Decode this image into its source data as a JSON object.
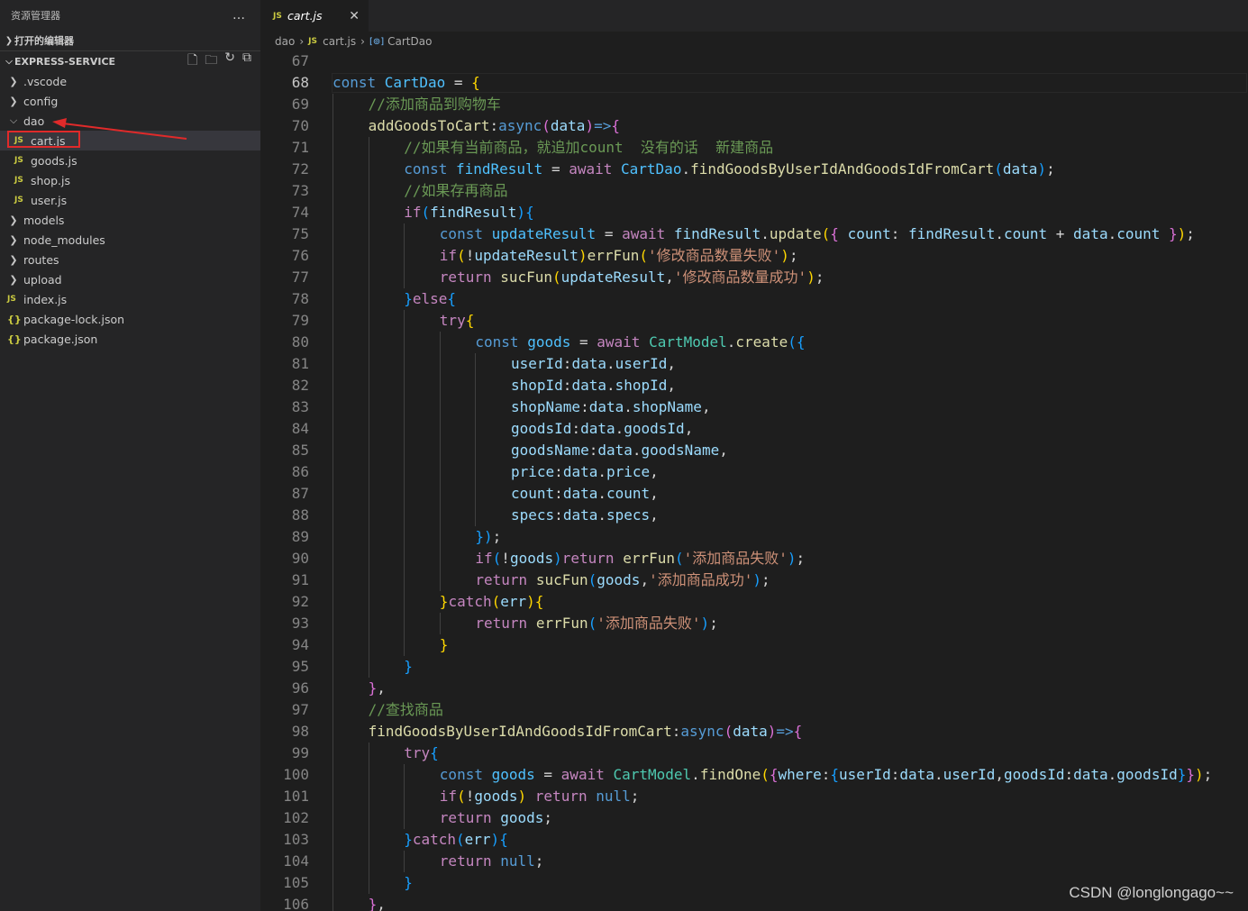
{
  "sidebar": {
    "title": "资源管理器",
    "more_icon": "…",
    "open_editors_label": "打开的编辑器",
    "project_label": "EXPRESS-SERVICE",
    "tree": [
      {
        "label": ".vscode",
        "kind": "folder",
        "level": 0,
        "expanded": false
      },
      {
        "label": "config",
        "kind": "folder",
        "level": 0,
        "expanded": false
      },
      {
        "label": "dao",
        "kind": "folder",
        "level": 0,
        "expanded": true
      },
      {
        "label": "cart.js",
        "kind": "js",
        "level": 1,
        "selected": true
      },
      {
        "label": "goods.js",
        "kind": "js",
        "level": 1
      },
      {
        "label": "shop.js",
        "kind": "js",
        "level": 1
      },
      {
        "label": "user.js",
        "kind": "js",
        "level": 1
      },
      {
        "label": "models",
        "kind": "folder",
        "level": 0,
        "expanded": false
      },
      {
        "label": "node_modules",
        "kind": "folder",
        "level": 0,
        "expanded": false
      },
      {
        "label": "routes",
        "kind": "folder",
        "level": 0,
        "expanded": false
      },
      {
        "label": "upload",
        "kind": "folder",
        "level": 0,
        "expanded": false
      },
      {
        "label": "index.js",
        "kind": "js",
        "level": 0
      },
      {
        "label": "package-lock.json",
        "kind": "json",
        "level": 0
      },
      {
        "label": "package.json",
        "kind": "json",
        "level": 0
      }
    ]
  },
  "tab": {
    "icon": "JS",
    "label": "cart.js",
    "close": "✕"
  },
  "breadcrumb": {
    "folder": "dao",
    "file": "cart.js",
    "symbol": "CartDao"
  },
  "editor": {
    "active_line": 68,
    "lines": [
      {
        "n": "67",
        "indent": 0,
        "tokens": []
      },
      {
        "n": "68",
        "indent": 0,
        "tokens": [
          [
            "k",
            "const "
          ],
          [
            "cv",
            "CartDao"
          ],
          [
            "p",
            " = "
          ],
          [
            "b1",
            "{"
          ]
        ]
      },
      {
        "n": "69",
        "indent": 1,
        "tokens": [
          [
            "cm",
            "//添加商品到购物车"
          ]
        ]
      },
      {
        "n": "70",
        "indent": 1,
        "tokens": [
          [
            "f",
            "addGoodsToCart"
          ],
          [
            "p",
            ":"
          ],
          [
            "k",
            "async"
          ],
          [
            "b2",
            "("
          ],
          [
            "v",
            "data"
          ],
          [
            "b2",
            ")"
          ],
          [
            "k",
            "=>"
          ],
          [
            "b2",
            "{"
          ]
        ]
      },
      {
        "n": "71",
        "indent": 2,
        "tokens": [
          [
            "cm",
            "//如果有当前商品，就追加count  没有的话  新建商品"
          ]
        ]
      },
      {
        "n": "72",
        "indent": 2,
        "tokens": [
          [
            "k",
            "const "
          ],
          [
            "cv",
            "findResult"
          ],
          [
            "p",
            " = "
          ],
          [
            "c",
            "await "
          ],
          [
            "cv",
            "CartDao"
          ],
          [
            "p",
            "."
          ],
          [
            "f",
            "findGoodsByUserIdAndGoodsIdFromCart"
          ],
          [
            "b3",
            "("
          ],
          [
            "v",
            "data"
          ],
          [
            "b3",
            ")"
          ],
          [
            "p",
            ";"
          ]
        ]
      },
      {
        "n": "73",
        "indent": 2,
        "tokens": [
          [
            "cm",
            "//如果存再商品"
          ]
        ]
      },
      {
        "n": "74",
        "indent": 2,
        "tokens": [
          [
            "c",
            "if"
          ],
          [
            "b3",
            "("
          ],
          [
            "v",
            "findResult"
          ],
          [
            "b3",
            ")"
          ],
          [
            "b3",
            "{"
          ]
        ]
      },
      {
        "n": "75",
        "indent": 3,
        "tokens": [
          [
            "k",
            "const "
          ],
          [
            "cv",
            "updateResult"
          ],
          [
            "p",
            " = "
          ],
          [
            "c",
            "await "
          ],
          [
            "v",
            "findResult"
          ],
          [
            "p",
            "."
          ],
          [
            "f",
            "update"
          ],
          [
            "b1",
            "("
          ],
          [
            "b2",
            "{ "
          ],
          [
            "v",
            "count"
          ],
          [
            "p",
            ": "
          ],
          [
            "v",
            "findResult"
          ],
          [
            "p",
            "."
          ],
          [
            "v",
            "count"
          ],
          [
            "p",
            " + "
          ],
          [
            "v",
            "data"
          ],
          [
            "p",
            "."
          ],
          [
            "v",
            "count"
          ],
          [
            "b2",
            " }"
          ],
          [
            "b1",
            ")"
          ],
          [
            "p",
            ";"
          ]
        ]
      },
      {
        "n": "76",
        "indent": 3,
        "tokens": [
          [
            "c",
            "if"
          ],
          [
            "b1",
            "("
          ],
          [
            "p",
            "!"
          ],
          [
            "v",
            "updateResult"
          ],
          [
            "b1",
            ")"
          ],
          [
            "f",
            "errFun"
          ],
          [
            "b1",
            "("
          ],
          [
            "s",
            "'修改商品数量失败'"
          ],
          [
            "b1",
            ")"
          ],
          [
            "p",
            ";"
          ]
        ]
      },
      {
        "n": "77",
        "indent": 3,
        "tokens": [
          [
            "c",
            "return "
          ],
          [
            "f",
            "sucFun"
          ],
          [
            "b1",
            "("
          ],
          [
            "v",
            "updateResult"
          ],
          [
            "p",
            ","
          ],
          [
            "s",
            "'修改商品数量成功'"
          ],
          [
            "b1",
            ")"
          ],
          [
            "p",
            ";"
          ]
        ]
      },
      {
        "n": "78",
        "indent": 2,
        "tokens": [
          [
            "b3",
            "}"
          ],
          [
            "c",
            "else"
          ],
          [
            "b3",
            "{"
          ]
        ]
      },
      {
        "n": "79",
        "indent": 3,
        "tokens": [
          [
            "c",
            "try"
          ],
          [
            "b1",
            "{"
          ]
        ]
      },
      {
        "n": "80",
        "indent": 4,
        "tokens": [
          [
            "k",
            "const "
          ],
          [
            "cv",
            "goods"
          ],
          [
            "p",
            " = "
          ],
          [
            "c",
            "await "
          ],
          [
            "t",
            "CartModel"
          ],
          [
            "p",
            "."
          ],
          [
            "f",
            "create"
          ],
          [
            "b3",
            "("
          ],
          [
            "b3",
            "{"
          ]
        ]
      },
      {
        "n": "81",
        "indent": 5,
        "tokens": [
          [
            "v",
            "userId"
          ],
          [
            "p",
            ":"
          ],
          [
            "v",
            "data"
          ],
          [
            "p",
            "."
          ],
          [
            "v",
            "userId"
          ],
          [
            "p",
            ","
          ]
        ]
      },
      {
        "n": "82",
        "indent": 5,
        "tokens": [
          [
            "v",
            "shopId"
          ],
          [
            "p",
            ":"
          ],
          [
            "v",
            "data"
          ],
          [
            "p",
            "."
          ],
          [
            "v",
            "shopId"
          ],
          [
            "p",
            ","
          ]
        ]
      },
      {
        "n": "83",
        "indent": 5,
        "tokens": [
          [
            "v",
            "shopName"
          ],
          [
            "p",
            ":"
          ],
          [
            "v",
            "data"
          ],
          [
            "p",
            "."
          ],
          [
            "v",
            "shopName"
          ],
          [
            "p",
            ","
          ]
        ]
      },
      {
        "n": "84",
        "indent": 5,
        "tokens": [
          [
            "v",
            "goodsId"
          ],
          [
            "p",
            ":"
          ],
          [
            "v",
            "data"
          ],
          [
            "p",
            "."
          ],
          [
            "v",
            "goodsId"
          ],
          [
            "p",
            ","
          ]
        ]
      },
      {
        "n": "85",
        "indent": 5,
        "tokens": [
          [
            "v",
            "goodsName"
          ],
          [
            "p",
            ":"
          ],
          [
            "v",
            "data"
          ],
          [
            "p",
            "."
          ],
          [
            "v",
            "goodsName"
          ],
          [
            "p",
            ","
          ]
        ]
      },
      {
        "n": "86",
        "indent": 5,
        "tokens": [
          [
            "v",
            "price"
          ],
          [
            "p",
            ":"
          ],
          [
            "v",
            "data"
          ],
          [
            "p",
            "."
          ],
          [
            "v",
            "price"
          ],
          [
            "p",
            ","
          ]
        ]
      },
      {
        "n": "87",
        "indent": 5,
        "tokens": [
          [
            "v",
            "count"
          ],
          [
            "p",
            ":"
          ],
          [
            "v",
            "data"
          ],
          [
            "p",
            "."
          ],
          [
            "v",
            "count"
          ],
          [
            "p",
            ","
          ]
        ]
      },
      {
        "n": "88",
        "indent": 5,
        "tokens": [
          [
            "v",
            "specs"
          ],
          [
            "p",
            ":"
          ],
          [
            "v",
            "data"
          ],
          [
            "p",
            "."
          ],
          [
            "v",
            "specs"
          ],
          [
            "p",
            ","
          ]
        ]
      },
      {
        "n": "89",
        "indent": 4,
        "tokens": [
          [
            "b3",
            "}"
          ],
          [
            "b3",
            ")"
          ],
          [
            "p",
            ";"
          ]
        ]
      },
      {
        "n": "90",
        "indent": 4,
        "tokens": [
          [
            "c",
            "if"
          ],
          [
            "b3",
            "("
          ],
          [
            "p",
            "!"
          ],
          [
            "v",
            "goods"
          ],
          [
            "b3",
            ")"
          ],
          [
            "c",
            "return "
          ],
          [
            "f",
            "errFun"
          ],
          [
            "b3",
            "("
          ],
          [
            "s",
            "'添加商品失败'"
          ],
          [
            "b3",
            ")"
          ],
          [
            "p",
            ";"
          ]
        ]
      },
      {
        "n": "91",
        "indent": 4,
        "tokens": [
          [
            "c",
            "return "
          ],
          [
            "f",
            "sucFun"
          ],
          [
            "b3",
            "("
          ],
          [
            "v",
            "goods"
          ],
          [
            "p",
            ","
          ],
          [
            "s",
            "'添加商品成功'"
          ],
          [
            "b3",
            ")"
          ],
          [
            "p",
            ";"
          ]
        ]
      },
      {
        "n": "92",
        "indent": 3,
        "tokens": [
          [
            "b1",
            "}"
          ],
          [
            "c",
            "catch"
          ],
          [
            "b1",
            "("
          ],
          [
            "v",
            "err"
          ],
          [
            "b1",
            ")"
          ],
          [
            "b1",
            "{"
          ]
        ]
      },
      {
        "n": "93",
        "indent": 4,
        "tokens": [
          [
            "c",
            "return "
          ],
          [
            "f",
            "errFun"
          ],
          [
            "b3",
            "("
          ],
          [
            "s",
            "'添加商品失败'"
          ],
          [
            "b3",
            ")"
          ],
          [
            "p",
            ";"
          ]
        ]
      },
      {
        "n": "94",
        "indent": 3,
        "tokens": [
          [
            "b1",
            "}"
          ]
        ]
      },
      {
        "n": "95",
        "indent": 2,
        "tokens": [
          [
            "b3",
            "}"
          ]
        ]
      },
      {
        "n": "96",
        "indent": 1,
        "tokens": [
          [
            "b2",
            "}"
          ],
          [
            "p",
            ","
          ]
        ]
      },
      {
        "n": "97",
        "indent": 1,
        "tokens": [
          [
            "cm",
            "//查找商品"
          ]
        ]
      },
      {
        "n": "98",
        "indent": 1,
        "tokens": [
          [
            "f",
            "findGoodsByUserIdAndGoodsIdFromCart"
          ],
          [
            "p",
            ":"
          ],
          [
            "k",
            "async"
          ],
          [
            "b2",
            "("
          ],
          [
            "v",
            "data"
          ],
          [
            "b2",
            ")"
          ],
          [
            "k",
            "=>"
          ],
          [
            "b2",
            "{"
          ]
        ]
      },
      {
        "n": "99",
        "indent": 2,
        "tokens": [
          [
            "c",
            "try"
          ],
          [
            "b3",
            "{"
          ]
        ]
      },
      {
        "n": "100",
        "indent": 3,
        "tokens": [
          [
            "k",
            "const "
          ],
          [
            "cv",
            "goods"
          ],
          [
            "p",
            " = "
          ],
          [
            "c",
            "await "
          ],
          [
            "t",
            "CartModel"
          ],
          [
            "p",
            "."
          ],
          [
            "f",
            "findOne"
          ],
          [
            "b1",
            "("
          ],
          [
            "b2",
            "{"
          ],
          [
            "v",
            "where"
          ],
          [
            "p",
            ":"
          ],
          [
            "b3",
            "{"
          ],
          [
            "v",
            "userId"
          ],
          [
            "p",
            ":"
          ],
          [
            "v",
            "data"
          ],
          [
            "p",
            "."
          ],
          [
            "v",
            "userId"
          ],
          [
            "p",
            ","
          ],
          [
            "v",
            "goodsId"
          ],
          [
            "p",
            ":"
          ],
          [
            "v",
            "data"
          ],
          [
            "p",
            "."
          ],
          [
            "v",
            "goodsId"
          ],
          [
            "b3",
            "}"
          ],
          [
            "b2",
            "}"
          ],
          [
            "b1",
            ")"
          ],
          [
            "p",
            ";"
          ]
        ]
      },
      {
        "n": "101",
        "indent": 3,
        "tokens": [
          [
            "c",
            "if"
          ],
          [
            "b1",
            "("
          ],
          [
            "p",
            "!"
          ],
          [
            "v",
            "goods"
          ],
          [
            "b1",
            ")"
          ],
          [
            "c",
            " return "
          ],
          [
            "k",
            "null"
          ],
          [
            "p",
            ";"
          ]
        ]
      },
      {
        "n": "102",
        "indent": 3,
        "tokens": [
          [
            "c",
            "return "
          ],
          [
            "v",
            "goods"
          ],
          [
            "p",
            ";"
          ]
        ]
      },
      {
        "n": "103",
        "indent": 2,
        "tokens": [
          [
            "b3",
            "}"
          ],
          [
            "c",
            "catch"
          ],
          [
            "b3",
            "("
          ],
          [
            "v",
            "err"
          ],
          [
            "b3",
            ")"
          ],
          [
            "b3",
            "{"
          ]
        ]
      },
      {
        "n": "104",
        "indent": 3,
        "tokens": [
          [
            "c",
            "return "
          ],
          [
            "k",
            "null"
          ],
          [
            "p",
            ";"
          ]
        ]
      },
      {
        "n": "105",
        "indent": 2,
        "tokens": [
          [
            "b3",
            "}"
          ]
        ]
      },
      {
        "n": "106",
        "indent": 1,
        "tokens": [
          [
            "b2",
            "}"
          ],
          [
            "p",
            ","
          ]
        ]
      }
    ]
  },
  "watermark": "CSDN @longlongago~~",
  "annotation_color": "#e02a2a"
}
